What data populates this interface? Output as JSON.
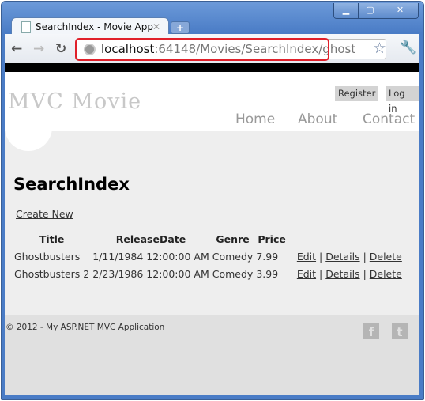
{
  "browser": {
    "tab_title": "SearchIndex - Movie App",
    "url_host": "localhost",
    "url_path": ":64148/Movies/SearchIndex/ghost",
    "accent_highlight": "#e0202a"
  },
  "site": {
    "logo": "MVC Movie",
    "register": "Register",
    "login": "Log in",
    "menu": [
      "Home",
      "About",
      "Contact"
    ]
  },
  "main": {
    "title": "SearchIndex",
    "create_new": "Create New",
    "columns": [
      "Title",
      "ReleaseDate",
      "Genre",
      "Price"
    ],
    "rows": [
      {
        "title": "Ghostbusters",
        "date": "1/11/1984 12:00:00 AM",
        "genre": "Comedy",
        "price": "7.99"
      },
      {
        "title": "Ghostbusters 2",
        "date": "2/23/1986 12:00:00 AM",
        "genre": "Comedy",
        "price": "3.99"
      }
    ],
    "actions": {
      "edit": "Edit",
      "details": "Details",
      "delete": "Delete",
      "sep": "|"
    }
  },
  "footer": {
    "copyright": "© 2012 - My ASP.NET MVC Application",
    "icons": [
      "facebook-icon",
      "twitter-icon"
    ]
  }
}
